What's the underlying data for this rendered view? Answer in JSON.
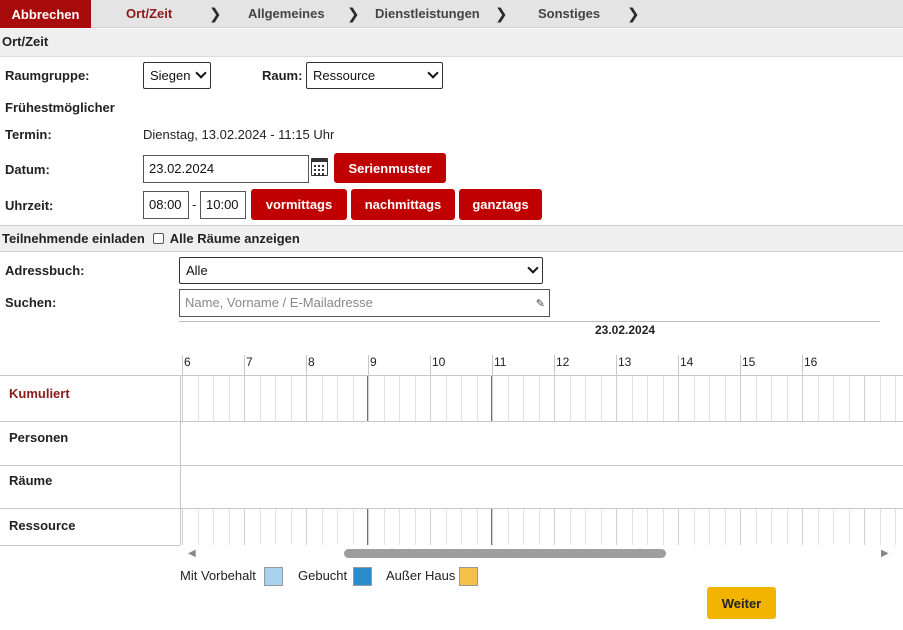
{
  "topbar": {
    "cancel_label": "Abbrechen",
    "steps": [
      "Ort/Zeit",
      "Allgemeines",
      "Dienstleistungen",
      "Sonstiges"
    ],
    "chevron_icon": "chevron-right-icon"
  },
  "ortzeit": {
    "section_title": "Ort/Zeit",
    "raumgruppe_label": "Raumgruppe:",
    "raumgruppe_value": "Siegen",
    "raum_label": "Raum:",
    "raum_value": "Ressource",
    "fruehest_label": "Frühestmöglicher",
    "termin_label": "Termin:",
    "termin_value": "Dienstag, 13.02.2024 - 11:15 Uhr",
    "datum_label": "Datum:",
    "datum_value": "23.02.2024",
    "serienmuster_label": "Serienmuster",
    "uhrzeit_label": "Uhrzeit:",
    "time_from": "08:00",
    "time_sep": "-",
    "time_to": "10:00",
    "vormittags_label": "vormittags",
    "nachmittags_label": "nachmittags",
    "ganztags_label": "ganztags"
  },
  "teilnehmende": {
    "section_title": "Teilnehmende einladen",
    "alle_raeume_label": "Alle Räume anzeigen",
    "alle_raeume_checked": false,
    "adressbuch_label": "Adressbuch:",
    "adressbuch_value": "Alle",
    "suchen_label": "Suchen:",
    "suchen_placeholder": "Name, Vorname / E-Mailadresse"
  },
  "timeline": {
    "date": "23.02.2024",
    "hours": [
      "6",
      "6",
      "7",
      "8",
      "9",
      "10",
      "11",
      "12",
      "13",
      "14",
      "15",
      "16"
    ],
    "rows": [
      "Kumuliert",
      "Personen",
      "Räume",
      "Ressource"
    ],
    "kumuliert_color": "#8b1a1a",
    "selection_color": "#2b7fd6"
  },
  "legend": {
    "items": [
      {
        "label": "Mit Vorbehalt",
        "color": "#a9d3ec"
      },
      {
        "label": "Gebucht",
        "color": "#2a8ccb"
      },
      {
        "label": "Außer Haus",
        "color": "#f5c04a"
      }
    ]
  },
  "footer": {
    "weiter_label": "Weiter"
  },
  "colors": {
    "primary_red": "#c00000",
    "cancel_red": "#a80b0b",
    "weiter_yellow": "#f3b400"
  }
}
